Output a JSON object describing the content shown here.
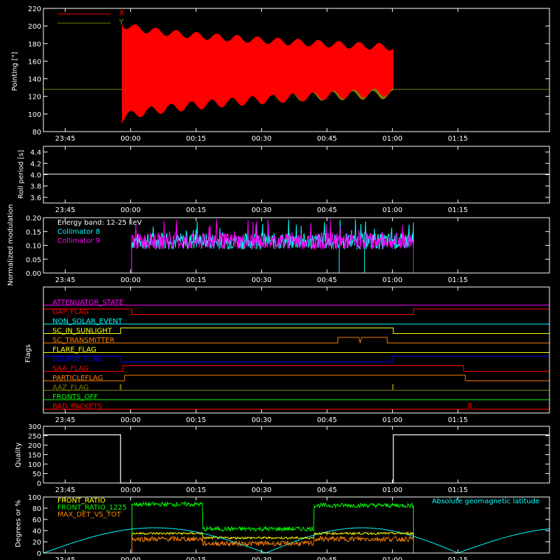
{
  "colors": {
    "background": "#000000",
    "axes": "#ffffff",
    "red": "#ff0000",
    "olive": "#808000",
    "cyan": "#00ffff",
    "magenta": "#ff00ff",
    "yellow": "#ffff00",
    "orange": "#ff8000",
    "green": "#00ff00",
    "blue": "#0000ff"
  },
  "time_axis": {
    "range_minutes": [
      -20,
      26
    ],
    "ticks": [
      {
        "t": -15,
        "label": "23:45"
      },
      {
        "t": 0,
        "label": "00:00"
      },
      {
        "t": 15,
        "label": "00:15"
      },
      {
        "t": 30,
        "label": "00:30"
      },
      {
        "t": 45,
        "label": "00:45"
      },
      {
        "t": 60,
        "label": "01:00"
      },
      {
        "t": 75,
        "label": "01:15"
      }
    ]
  },
  "chart_data": [
    {
      "id": "pointing",
      "type": "line",
      "ylabel": "Pointing [\"]",
      "ylim": [
        80,
        220
      ],
      "yticks": [
        "80",
        "100",
        "120",
        "140",
        "160",
        "180",
        "200",
        "220"
      ],
      "legend_placement": "top-left",
      "series": [
        {
          "name": "X",
          "color": "#ff0000",
          "baseline": 128,
          "active_range": [
            -2,
            60.2
          ],
          "envelope": {
            "start_min": 93,
            "start_max": 204,
            "end_min": 125,
            "end_max": 176
          }
        },
        {
          "name": "Y",
          "color": "#808000",
          "baseline": 128,
          "active_range": [
            -2,
            60.2
          ],
          "envelope": {
            "start_min": 108,
            "start_max": 190,
            "end_min": 122,
            "end_max": 170
          }
        }
      ]
    },
    {
      "id": "roll",
      "type": "line",
      "ylabel": "Roll period [s]",
      "ylim": [
        3.5,
        4.5
      ],
      "yticks": [
        "3.6",
        "3.8",
        "4.0",
        "4.2",
        "4.4"
      ],
      "series": [
        {
          "name": "",
          "color": "#ffffff",
          "value": 4.01
        }
      ]
    },
    {
      "id": "modulation",
      "type": "line",
      "ylabel": "Normalized modulation",
      "ylim": [
        0,
        0.2
      ],
      "yticks": [
        "0.00",
        "0.05",
        "0.10",
        "0.15",
        "0.20"
      ],
      "annotation": "Energy band: 12-25 keV",
      "series": [
        {
          "name": "Collimator 8",
          "color": "#00ffff",
          "active_range": [
            0.2,
            64.8
          ],
          "mean": 0.115
        },
        {
          "name": "Collimator 9",
          "color": "#ff00ff",
          "active_range": [
            0.2,
            64.8
          ],
          "mean": 0.115
        }
      ]
    },
    {
      "id": "flags",
      "type": "line",
      "ylabel": "Flags",
      "series": [
        {
          "name": "ATTENUATOR_STATE",
          "color": "#ff00ff",
          "segments": [
            [
              -20,
              0
            ],
            [
              96,
              0
            ]
          ]
        },
        {
          "name": "GAP_FLAG",
          "color": "#ff0000",
          "segments": [
            [
              -20,
              1
            ],
            [
              0.3,
              1
            ],
            [
              0.3,
              0
            ],
            [
              64.8,
              0
            ],
            [
              64.8,
              1
            ],
            [
              96,
              1
            ]
          ]
        },
        {
          "name": "NON_SOLAR_EVENT",
          "color": "#00ffff",
          "segments": [
            [
              -20,
              0
            ],
            [
              96,
              0
            ]
          ]
        },
        {
          "name": "SC_IN_SUNLIGHT",
          "color": "#ffff00",
          "segments": [
            [
              -20,
              0
            ],
            [
              -2.3,
              0
            ],
            [
              -2.3,
              1
            ],
            [
              60.2,
              1
            ],
            [
              60.2,
              0
            ],
            [
              96,
              0
            ]
          ]
        },
        {
          "name": "SC_TRANSMITTER",
          "color": "#ff8000",
          "segments": [
            [
              -20,
              0
            ],
            [
              47.5,
              0
            ],
            [
              47.5,
              1
            ],
            [
              52.3,
              1
            ],
            [
              52.6,
              0
            ],
            [
              52.9,
              1
            ],
            [
              58.8,
              1
            ],
            [
              58.8,
              0
            ],
            [
              96,
              0
            ]
          ]
        },
        {
          "name": "FLARE_FLAG",
          "color": "#ffff00",
          "segments": [
            [
              -20,
              0
            ],
            [
              96,
              0
            ]
          ]
        },
        {
          "name": "ECLIPSE_FLAG",
          "color": "#0000ff",
          "segments": [
            [
              -20,
              1
            ],
            [
              -2.2,
              1
            ],
            [
              -2.2,
              0
            ],
            [
              60.1,
              0
            ],
            [
              60.1,
              1
            ],
            [
              96,
              1
            ]
          ]
        },
        {
          "name": "SAA_FLAG",
          "color": "#ff0000",
          "segments": [
            [
              -20,
              0
            ],
            [
              -1.8,
              0
            ],
            [
              -1.8,
              1
            ],
            [
              76.3,
              1
            ],
            [
              76.3,
              0
            ],
            [
              96,
              0
            ]
          ]
        },
        {
          "name": "PARTICLEFLAG",
          "color": "#ff8000",
          "segments": [
            [
              -20,
              0
            ],
            [
              -1.4,
              0
            ],
            [
              -1.4,
              1
            ],
            [
              76.7,
              1
            ],
            [
              76.7,
              0
            ],
            [
              96,
              0
            ]
          ]
        },
        {
          "name": "AAZ_FLAG",
          "color": "#808000",
          "segments": [
            [
              -20,
              0
            ],
            [
              -2.4,
              0
            ],
            [
              -2.4,
              1
            ],
            [
              -2.2,
              1
            ],
            [
              -2.2,
              0
            ],
            [
              60.0,
              0
            ],
            [
              60.0,
              1
            ],
            [
              60.2,
              1
            ],
            [
              60.2,
              0
            ],
            [
              96,
              0
            ]
          ]
        },
        {
          "name": "FRONTS_OFF",
          "color": "#00ff00",
          "segments": [
            [
              -20,
              0
            ],
            [
              96,
              0
            ]
          ]
        },
        {
          "name": "BAD_PACKETS",
          "color": "#ff0000",
          "segments": [
            [
              -20,
              0
            ],
            [
              77.5,
              0
            ],
            [
              77.5,
              1
            ],
            [
              78.0,
              1
            ],
            [
              78.0,
              0
            ],
            [
              96,
              0
            ]
          ]
        }
      ]
    },
    {
      "id": "quality",
      "type": "line",
      "ylabel": "Quality",
      "ylim": [
        0,
        300
      ],
      "yticks": [
        "0",
        "50",
        "100",
        "150",
        "200",
        "250",
        "300"
      ],
      "series": [
        {
          "name": "",
          "color": "#ffffff",
          "points": [
            [
              -20,
              255
            ],
            [
              -2.3,
              255
            ],
            [
              -2.3,
              0
            ],
            [
              60.2,
              0
            ],
            [
              60.2,
              255
            ],
            [
              96,
              255
            ]
          ]
        }
      ]
    },
    {
      "id": "ratios",
      "type": "line",
      "ylabel": "Degrees or %",
      "ylim": [
        0,
        100
      ],
      "yticks": [
        "0",
        "20",
        "40",
        "60",
        "80",
        "100"
      ],
      "legend_placement": "top-left",
      "series": [
        {
          "name": "FRONT_RATIO",
          "color": "#ffff00",
          "level": 35
        },
        {
          "name": "FRONT_RATIO_1225",
          "color": "#00ff00",
          "levels": [
            [
              0.3,
              16.5,
              87
            ],
            [
              16.5,
              42,
              43
            ],
            [
              42,
              64.8,
              85
            ]
          ]
        },
        {
          "name": "MAX_DET_VS_TOT",
          "color": "#ff8000",
          "level": 25
        },
        {
          "name": "Absolute geomagnetic latitude",
          "color": "#00ffff",
          "peaks": [
            [
              -3,
              45
            ],
            [
              47,
              45
            ]
          ],
          "troughs": [
            [
              -20,
              0
            ],
            [
              31,
              0
            ],
            [
              75,
              0
            ]
          ]
        }
      ]
    }
  ]
}
